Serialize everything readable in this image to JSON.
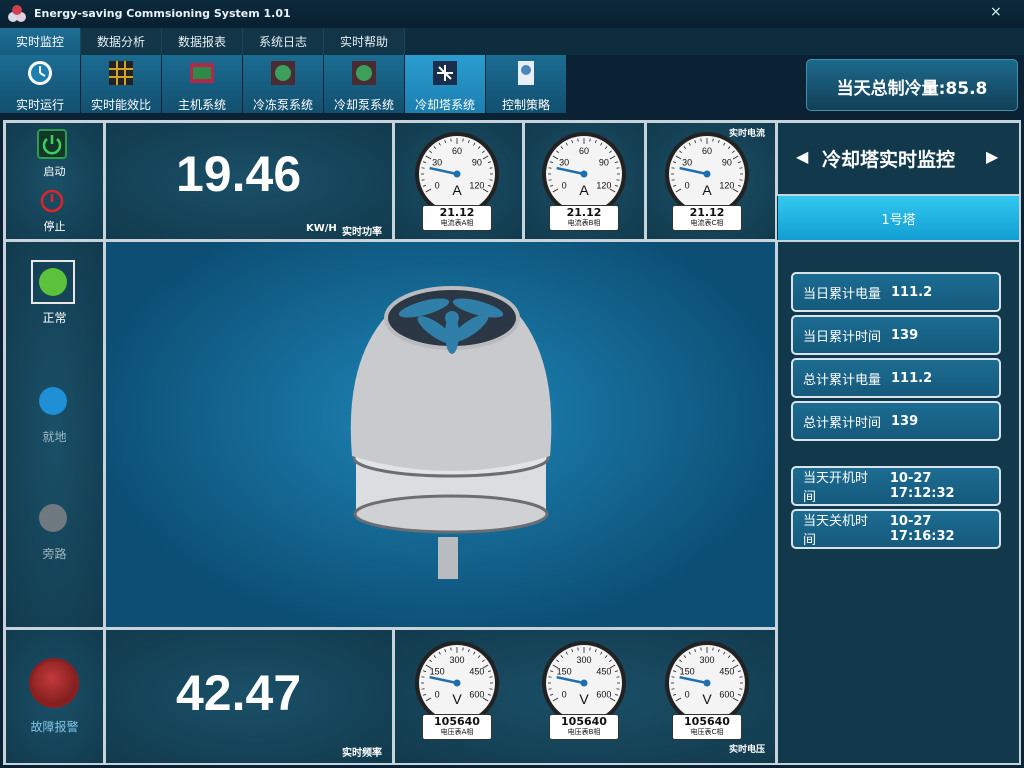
{
  "window": {
    "title": "Energy-saving Commsioning System 1.01",
    "close": "×"
  },
  "menu": [
    {
      "label": "实时监控",
      "active": true
    },
    {
      "label": "数据分析"
    },
    {
      "label": "数据报表"
    },
    {
      "label": "系统日志"
    },
    {
      "label": "实时帮助"
    }
  ],
  "toolbar": [
    {
      "label": "实时运行",
      "icon": "clock-icon",
      "color": "#1d7fb0"
    },
    {
      "label": "实时能效比",
      "icon": "grid-icon",
      "color": "#d4a21e"
    },
    {
      "label": "主机系统",
      "icon": "chiller-icon",
      "color": "#2f8a4a"
    },
    {
      "label": "冷冻泵系统",
      "icon": "pump-icon",
      "color": "#3c9f5a"
    },
    {
      "label": "冷却泵系统",
      "icon": "pump-icon",
      "color": "#3c9f5a"
    },
    {
      "label": "冷却塔系统",
      "icon": "tower-icon",
      "color": "#1f4e7a",
      "active": true
    },
    {
      "label": "控制策略",
      "icon": "strategy-icon",
      "color": "#4a86b8"
    }
  ],
  "daily_cooling": "当天总制冷量:85.8",
  "controls": {
    "start": "启动",
    "stop": "停止"
  },
  "power": {
    "value": "19.46",
    "unit": "KW/H",
    "label": "实时功率"
  },
  "current": {
    "title": "实时电流",
    "unit": "A",
    "ticks": [
      "0",
      "30",
      "60",
      "90",
      "120"
    ],
    "meters": [
      {
        "value": "21.12",
        "name": "电流表A相",
        "reading": 21.12
      },
      {
        "value": "21.12",
        "name": "电流表B相",
        "reading": 21.12
      },
      {
        "value": "21.12",
        "name": "电流表C相",
        "reading": 21.12
      }
    ],
    "max": 120
  },
  "panel_title": "冷却塔实时监控",
  "tower_tab": "1号塔",
  "status": [
    {
      "label": "正常",
      "color": "#5cc13b"
    },
    {
      "label": "就地",
      "color": "#1f8fd6"
    },
    {
      "label": "旁路",
      "color": "#6f7a80"
    }
  ],
  "stats": [
    {
      "label": "当日累计电量",
      "value": "111.2"
    },
    {
      "label": "当日累计时间",
      "value": "139"
    },
    {
      "label": "总计累计电量",
      "value": "111.2"
    },
    {
      "label": "总计累计时间",
      "value": "139"
    },
    {
      "label": "当天开机时间",
      "value": "10-27 17:12:32"
    },
    {
      "label": "当天关机时间",
      "value": "10-27 17:16:32"
    }
  ],
  "frequency": {
    "value": "42.47",
    "label": "实时频率"
  },
  "voltage": {
    "title": "实时电压",
    "unit": "V",
    "ticks": [
      "0",
      "150",
      "300",
      "450",
      "600"
    ],
    "meters": [
      {
        "value": "105640",
        "name": "电压表A相",
        "reading": 105
      },
      {
        "value": "105640",
        "name": "电压表B相",
        "reading": 105
      },
      {
        "value": "105640",
        "name": "电压表C相",
        "reading": 105
      }
    ],
    "max": 600
  },
  "alarm": "故障报警"
}
